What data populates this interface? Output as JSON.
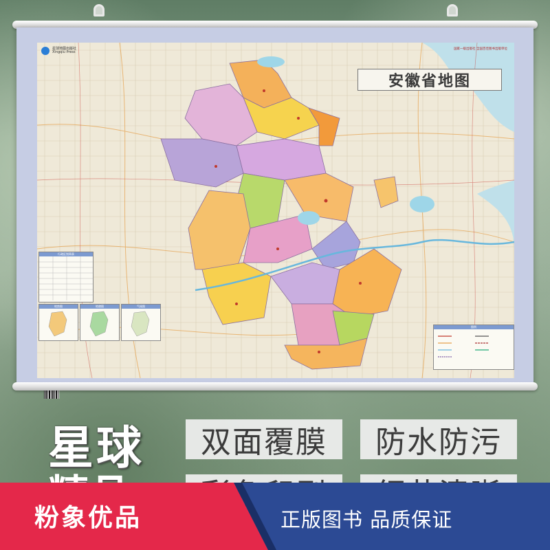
{
  "map": {
    "publisher": "星球地图出版社",
    "publisher_en": "Xingqiu Press",
    "top_note": "国家一级出版社  全国百佳图书出版单位",
    "title": "安徽省地图",
    "table_title": "行政区划简表",
    "inset1_title": "地势图",
    "inset2_title": "地貌图",
    "inset3_title": "气候图",
    "legend_title": "图例"
  },
  "product": {
    "brand": "星球",
    "brand_line2": "精品",
    "features": [
      "双面覆膜",
      "防水防污",
      "彩色印刷",
      "细节清晰"
    ]
  },
  "banner": {
    "left": "粉象优品",
    "right": "正版图书 品质保证",
    "colors": {
      "left": "#e4284a",
      "right": "#2c4a94"
    }
  }
}
